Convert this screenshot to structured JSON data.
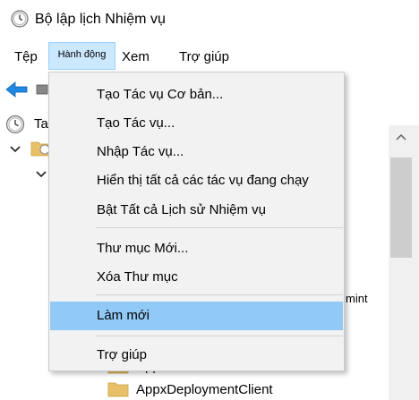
{
  "window": {
    "title": "Bộ lập lịch Nhiệm vụ",
    "icon": "clock-icon"
  },
  "menubar": {
    "file": "Tệp",
    "action": "Hành động",
    "view": "Xem",
    "help": "Trợ giúp"
  },
  "toolbar": {
    "back_icon": "back-arrow-icon",
    "second_icon": "console-icon"
  },
  "tree": {
    "root_label": "Ta",
    "partial_text": "mint",
    "folders": [
      {
        "label": "ApplicationData"
      },
      {
        "label": "AppxDeploymentClient"
      }
    ]
  },
  "dropdown": {
    "items": [
      "Tạo Tác vụ Cơ bản...",
      "Tạo Tác vụ...",
      "Nhập Tác vụ...",
      "Hiển thị tất cả các tác vụ đang chạy",
      "Bật Tất cả Lịch sử Nhiệm vụ",
      "Thư mục Mới...",
      "Xóa Thư mục",
      "Làm mới",
      "Trợ giúp"
    ],
    "highlighted_item": "Làm mới"
  },
  "colors": {
    "menu_active_bg": "#cce8ff",
    "highlight_bg": "#91c9f7",
    "dropdown_bg": "#f2f2f2",
    "accent_blue": "#1e88e5"
  }
}
